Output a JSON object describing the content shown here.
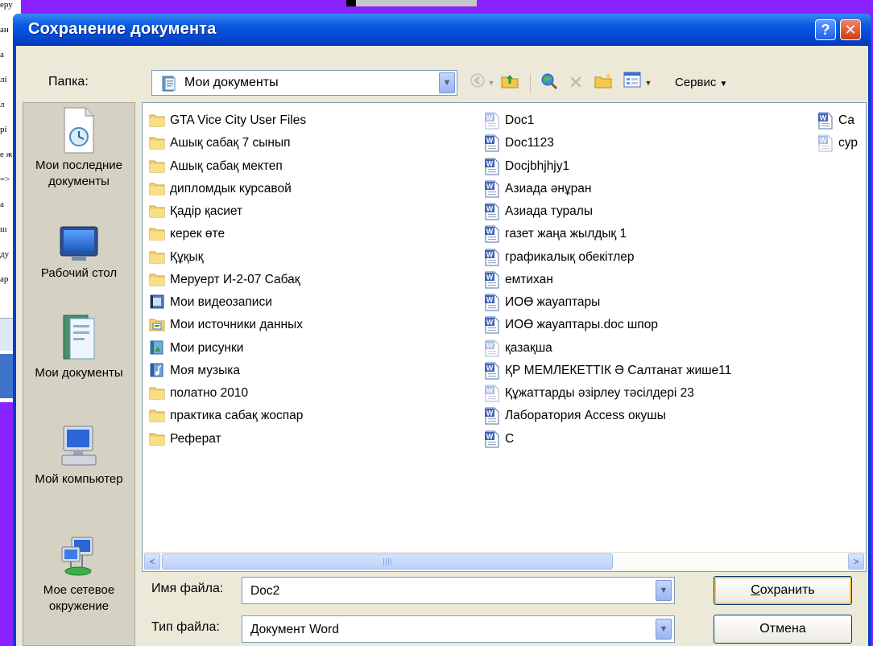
{
  "dialog": {
    "title": "Сохранение документа",
    "help_glyph": "?",
    "close_glyph": "✕"
  },
  "folder": {
    "label": "Папка:",
    "current": "Мои документы"
  },
  "toolbar": {
    "service_label": "Сервис",
    "icons": [
      "back-icon",
      "up-folder-icon",
      "search-web-icon",
      "delete-icon",
      "new-folder-icon",
      "views-icon"
    ]
  },
  "places": [
    {
      "label": "Мои последние документы",
      "icon": "recent-documents-icon"
    },
    {
      "label": "Рабочий стол",
      "icon": "desktop-icon"
    },
    {
      "label": "Мои документы",
      "icon": "my-documents-icon"
    },
    {
      "label": "Мой компьютер",
      "icon": "my-computer-icon"
    },
    {
      "label": "Мое сетевое окружение",
      "icon": "network-places-icon"
    }
  ],
  "files": {
    "column1": [
      {
        "name": "GTA Vice City User Files",
        "type": "folder"
      },
      {
        "name": "Ашық сабақ 7 сынып",
        "type": "folder"
      },
      {
        "name": "Ашық сабақ мектеп",
        "type": "folder"
      },
      {
        "name": "дипломдык курсавой",
        "type": "folder"
      },
      {
        "name": "Қадір қасиет",
        "type": "folder"
      },
      {
        "name": "керек өте",
        "type": "folder"
      },
      {
        "name": "Құқық",
        "type": "folder"
      },
      {
        "name": "Меруерт И-2-07 Сабақ",
        "type": "folder"
      },
      {
        "name": "Мои видеозаписи",
        "type": "video-folder"
      },
      {
        "name": "Мои источники данных",
        "type": "data-folder"
      },
      {
        "name": "Мои рисунки",
        "type": "pictures-folder"
      },
      {
        "name": "Моя музыка",
        "type": "music-folder"
      },
      {
        "name": "полатно 2010",
        "type": "folder"
      },
      {
        "name": "практика сабақ жоспар",
        "type": "folder"
      },
      {
        "name": "Реферат",
        "type": "folder"
      }
    ],
    "column2": [
      {
        "name": "Doc1",
        "type": "doc-light"
      },
      {
        "name": "Doc1123",
        "type": "doc"
      },
      {
        "name": "Docjbhjhjy1",
        "type": "doc"
      },
      {
        "name": "Азиада әнұран",
        "type": "doc"
      },
      {
        "name": "Азиада туралы",
        "type": "doc"
      },
      {
        "name": "газет жаңа жылдық 1",
        "type": "doc"
      },
      {
        "name": "графикалық обекітлер",
        "type": "doc"
      },
      {
        "name": "емтихан",
        "type": "doc"
      },
      {
        "name": "ИОӨ жауаптары",
        "type": "doc"
      },
      {
        "name": "ИОӨ жауаптары.doc шпор",
        "type": "doc"
      },
      {
        "name": "қазақша",
        "type": "doc-light"
      },
      {
        "name": "ҚР МЕМЛЕКЕТТІК Ә Салтанат жише11",
        "type": "doc"
      },
      {
        "name": "Құжаттарды әзірлеу тәсілдері 23",
        "type": "doc-light"
      },
      {
        "name": "Лаборатория Access окушы",
        "type": "doc"
      },
      {
        "name": "С",
        "type": "doc"
      }
    ],
    "column3": [
      {
        "name": "Са",
        "type": "doc"
      },
      {
        "name": "сур",
        "type": "doc-light"
      }
    ]
  },
  "scrollbar": {
    "left_arrow": "<",
    "right_arrow": ">",
    "thumb_position": 0.0
  },
  "filename": {
    "label": "Имя файла:",
    "value": "Doc2"
  },
  "filetype": {
    "label": "Тип файла:",
    "value": "Документ Word"
  },
  "buttons": {
    "save": {
      "mnemonic": "С",
      "rest": "охранить"
    },
    "cancel": "Отмена"
  },
  "background_fragments": [
    "еру",
    "ан",
    "а",
    "лі",
    "л",
    "рі",
    "е ж",
    "=>",
    "а",
    "ш",
    "ду",
    "ар"
  ],
  "colors": {
    "border_purple": "#8a22ff",
    "titlebar_blue": "#0b5be0",
    "dialog_face": "#ece9d8",
    "folder_yellow": "#f6d66a"
  }
}
